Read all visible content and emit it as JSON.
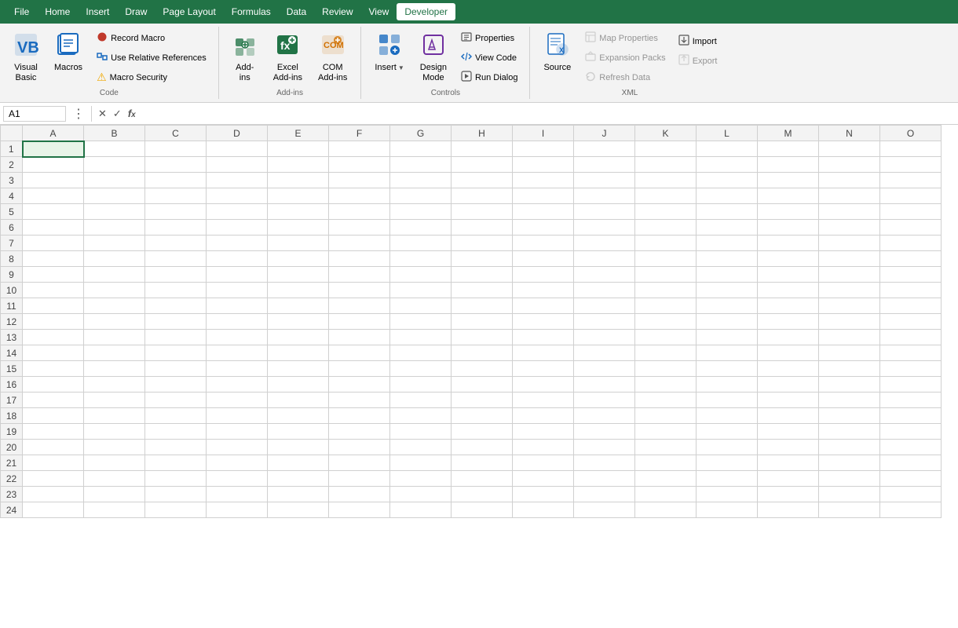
{
  "menubar": {
    "app": "Excel",
    "items": [
      {
        "id": "file",
        "label": "File"
      },
      {
        "id": "home",
        "label": "Home"
      },
      {
        "id": "insert",
        "label": "Insert"
      },
      {
        "id": "draw",
        "label": "Draw"
      },
      {
        "id": "page-layout",
        "label": "Page Layout"
      },
      {
        "id": "formulas",
        "label": "Formulas"
      },
      {
        "id": "data",
        "label": "Data"
      },
      {
        "id": "review",
        "label": "Review"
      },
      {
        "id": "view",
        "label": "View"
      },
      {
        "id": "developer",
        "label": "Developer"
      }
    ]
  },
  "ribbon": {
    "groups": [
      {
        "id": "code",
        "label": "Code",
        "items": [
          {
            "type": "large",
            "id": "visual-basic",
            "label": "Visual\nBasic",
            "icon": "vb"
          },
          {
            "type": "large",
            "id": "macros",
            "label": "Macros",
            "icon": "macros"
          },
          {
            "type": "small-stack",
            "items": [
              {
                "id": "record-macro",
                "label": "Record Macro",
                "icon": "record"
              },
              {
                "id": "use-relative-references",
                "label": "Use Relative References",
                "icon": "relative"
              },
              {
                "id": "macro-security",
                "label": "Macro Security",
                "icon": "warning"
              }
            ]
          }
        ]
      },
      {
        "id": "add-ins",
        "label": "Add-ins",
        "items": [
          {
            "type": "large",
            "id": "add-ins",
            "label": "Add-\nins",
            "icon": "addins"
          },
          {
            "type": "large",
            "id": "excel-add-ins",
            "label": "Excel\nAdd-ins",
            "icon": "exceladdin"
          },
          {
            "type": "large",
            "id": "com-add-ins",
            "label": "COM\nAdd-ins",
            "icon": "comaddin"
          }
        ]
      },
      {
        "id": "controls",
        "label": "Controls",
        "items": [
          {
            "type": "large-split",
            "id": "insert-control",
            "label": "Insert",
            "icon": "insert"
          },
          {
            "type": "large",
            "id": "design-mode",
            "label": "Design\nMode",
            "icon": "design"
          },
          {
            "type": "small-stack",
            "items": [
              {
                "id": "properties",
                "label": "Properties",
                "icon": "properties"
              },
              {
                "id": "view-code",
                "label": "View Code",
                "icon": "viewcode"
              },
              {
                "id": "run-dialog",
                "label": "Run Dialog",
                "icon": "rundialog"
              }
            ]
          }
        ]
      },
      {
        "id": "xml",
        "label": "XML",
        "items": [
          {
            "type": "large",
            "id": "source",
            "label": "Source",
            "icon": "source"
          },
          {
            "type": "small-stack",
            "items": [
              {
                "id": "map-properties",
                "label": "Map Properties",
                "icon": "map",
                "disabled": true
              },
              {
                "id": "expansion-packs",
                "label": "Expansion Packs",
                "icon": "expansion",
                "disabled": true
              },
              {
                "id": "refresh-data",
                "label": "Refresh Data",
                "icon": "refresh",
                "disabled": true
              }
            ]
          },
          {
            "type": "small-stack",
            "items": [
              {
                "id": "import",
                "label": "Import",
                "icon": "import"
              },
              {
                "id": "export",
                "label": "Export",
                "icon": "export",
                "disabled": true
              }
            ]
          }
        ]
      }
    ]
  },
  "formulabar": {
    "cellref": "A1",
    "formula": ""
  },
  "spreadsheet": {
    "columns": [
      "A",
      "B",
      "C",
      "D",
      "E",
      "F",
      "G",
      "H",
      "I",
      "J",
      "K",
      "L",
      "M",
      "N",
      "O"
    ],
    "rows": 24,
    "selected_cell": "A1"
  }
}
